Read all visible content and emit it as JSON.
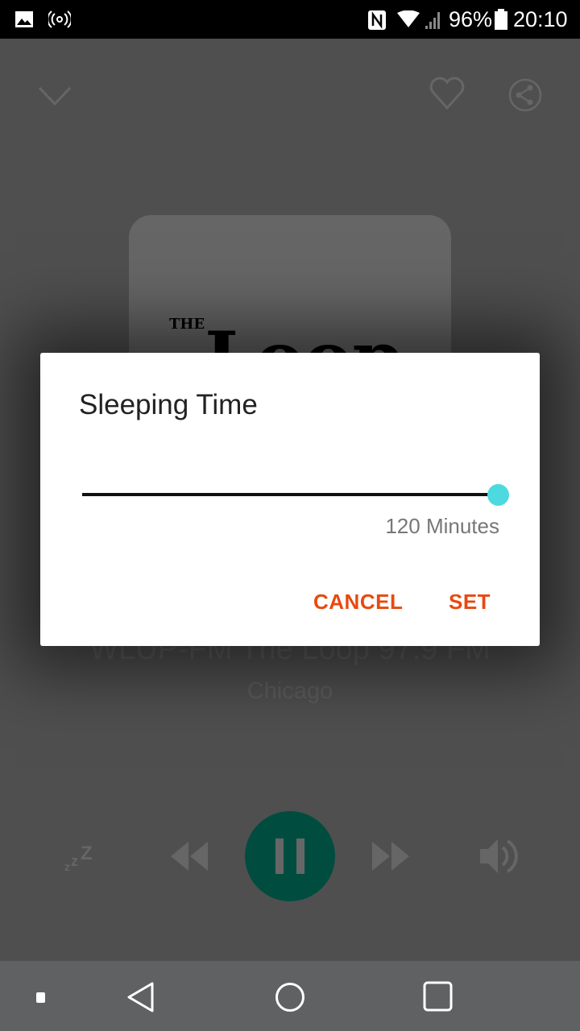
{
  "status_bar": {
    "battery": "96%",
    "time": "20:10",
    "icons": [
      "image-icon",
      "hotspot-icon",
      "nfc-icon",
      "wifi-icon",
      "signal-icon",
      "battery-icon"
    ]
  },
  "player": {
    "station": "WLUP-FM The Loop 97.9 FM",
    "location": "Chicago",
    "artwork_text": "THE Loop",
    "accent": "#004d40"
  },
  "dialog": {
    "title": "Sleeping Time",
    "slider_value_label": "120 Minutes",
    "slider_fraction": 1.0,
    "slider_color": "#4dd9e0",
    "cancel": "CANCEL",
    "set": "SET",
    "button_color": "#e8490f"
  }
}
